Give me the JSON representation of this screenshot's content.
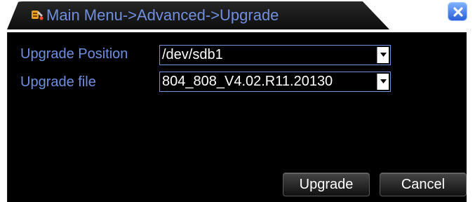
{
  "window": {
    "title": "Main Menu->Advanced->Upgrade",
    "app_icon": "tools-icon",
    "close_icon": "close-icon",
    "accent_color": "#6f8fe0",
    "body_color": "#000000"
  },
  "form": {
    "upgrade_position": {
      "label": "Upgrade Position",
      "value": "/dev/sdb1"
    },
    "upgrade_file": {
      "label": "Upgrade file",
      "value": "804_808_V4.02.R11.20130"
    }
  },
  "buttons": {
    "upgrade_label": "Upgrade",
    "cancel_label": "Cancel"
  }
}
